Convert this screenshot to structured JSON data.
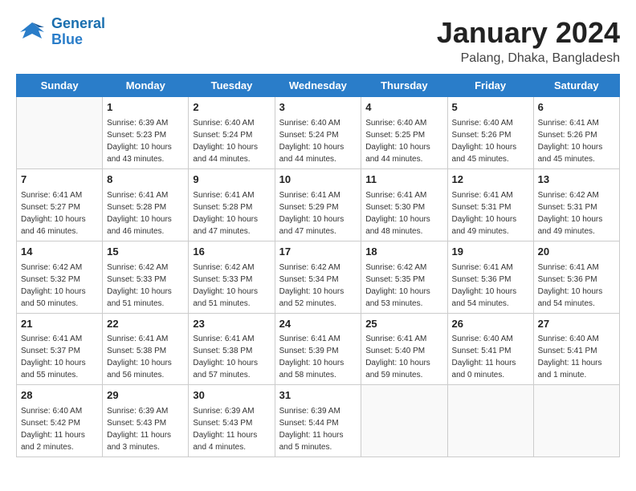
{
  "header": {
    "logo": {
      "line1": "General",
      "line2": "Blue"
    },
    "month_year": "January 2024",
    "location": "Palang, Dhaka, Bangladesh"
  },
  "days_of_week": [
    "Sunday",
    "Monday",
    "Tuesday",
    "Wednesday",
    "Thursday",
    "Friday",
    "Saturday"
  ],
  "weeks": [
    [
      {
        "day": "",
        "detail": ""
      },
      {
        "day": "1",
        "detail": "Sunrise: 6:39 AM\nSunset: 5:23 PM\nDaylight: 10 hours\nand 43 minutes."
      },
      {
        "day": "2",
        "detail": "Sunrise: 6:40 AM\nSunset: 5:24 PM\nDaylight: 10 hours\nand 44 minutes."
      },
      {
        "day": "3",
        "detail": "Sunrise: 6:40 AM\nSunset: 5:24 PM\nDaylight: 10 hours\nand 44 minutes."
      },
      {
        "day": "4",
        "detail": "Sunrise: 6:40 AM\nSunset: 5:25 PM\nDaylight: 10 hours\nand 44 minutes."
      },
      {
        "day": "5",
        "detail": "Sunrise: 6:40 AM\nSunset: 5:26 PM\nDaylight: 10 hours\nand 45 minutes."
      },
      {
        "day": "6",
        "detail": "Sunrise: 6:41 AM\nSunset: 5:26 PM\nDaylight: 10 hours\nand 45 minutes."
      }
    ],
    [
      {
        "day": "7",
        "detail": "Sunrise: 6:41 AM\nSunset: 5:27 PM\nDaylight: 10 hours\nand 46 minutes."
      },
      {
        "day": "8",
        "detail": "Sunrise: 6:41 AM\nSunset: 5:28 PM\nDaylight: 10 hours\nand 46 minutes."
      },
      {
        "day": "9",
        "detail": "Sunrise: 6:41 AM\nSunset: 5:28 PM\nDaylight: 10 hours\nand 47 minutes."
      },
      {
        "day": "10",
        "detail": "Sunrise: 6:41 AM\nSunset: 5:29 PM\nDaylight: 10 hours\nand 47 minutes."
      },
      {
        "day": "11",
        "detail": "Sunrise: 6:41 AM\nSunset: 5:30 PM\nDaylight: 10 hours\nand 48 minutes."
      },
      {
        "day": "12",
        "detail": "Sunrise: 6:41 AM\nSunset: 5:31 PM\nDaylight: 10 hours\nand 49 minutes."
      },
      {
        "day": "13",
        "detail": "Sunrise: 6:42 AM\nSunset: 5:31 PM\nDaylight: 10 hours\nand 49 minutes."
      }
    ],
    [
      {
        "day": "14",
        "detail": "Sunrise: 6:42 AM\nSunset: 5:32 PM\nDaylight: 10 hours\nand 50 minutes."
      },
      {
        "day": "15",
        "detail": "Sunrise: 6:42 AM\nSunset: 5:33 PM\nDaylight: 10 hours\nand 51 minutes."
      },
      {
        "day": "16",
        "detail": "Sunrise: 6:42 AM\nSunset: 5:33 PM\nDaylight: 10 hours\nand 51 minutes."
      },
      {
        "day": "17",
        "detail": "Sunrise: 6:42 AM\nSunset: 5:34 PM\nDaylight: 10 hours\nand 52 minutes."
      },
      {
        "day": "18",
        "detail": "Sunrise: 6:42 AM\nSunset: 5:35 PM\nDaylight: 10 hours\nand 53 minutes."
      },
      {
        "day": "19",
        "detail": "Sunrise: 6:41 AM\nSunset: 5:36 PM\nDaylight: 10 hours\nand 54 minutes."
      },
      {
        "day": "20",
        "detail": "Sunrise: 6:41 AM\nSunset: 5:36 PM\nDaylight: 10 hours\nand 54 minutes."
      }
    ],
    [
      {
        "day": "21",
        "detail": "Sunrise: 6:41 AM\nSunset: 5:37 PM\nDaylight: 10 hours\nand 55 minutes."
      },
      {
        "day": "22",
        "detail": "Sunrise: 6:41 AM\nSunset: 5:38 PM\nDaylight: 10 hours\nand 56 minutes."
      },
      {
        "day": "23",
        "detail": "Sunrise: 6:41 AM\nSunset: 5:38 PM\nDaylight: 10 hours\nand 57 minutes."
      },
      {
        "day": "24",
        "detail": "Sunrise: 6:41 AM\nSunset: 5:39 PM\nDaylight: 10 hours\nand 58 minutes."
      },
      {
        "day": "25",
        "detail": "Sunrise: 6:41 AM\nSunset: 5:40 PM\nDaylight: 10 hours\nand 59 minutes."
      },
      {
        "day": "26",
        "detail": "Sunrise: 6:40 AM\nSunset: 5:41 PM\nDaylight: 11 hours\nand 0 minutes."
      },
      {
        "day": "27",
        "detail": "Sunrise: 6:40 AM\nSunset: 5:41 PM\nDaylight: 11 hours\nand 1 minute."
      }
    ],
    [
      {
        "day": "28",
        "detail": "Sunrise: 6:40 AM\nSunset: 5:42 PM\nDaylight: 11 hours\nand 2 minutes."
      },
      {
        "day": "29",
        "detail": "Sunrise: 6:39 AM\nSunset: 5:43 PM\nDaylight: 11 hours\nand 3 minutes."
      },
      {
        "day": "30",
        "detail": "Sunrise: 6:39 AM\nSunset: 5:43 PM\nDaylight: 11 hours\nand 4 minutes."
      },
      {
        "day": "31",
        "detail": "Sunrise: 6:39 AM\nSunset: 5:44 PM\nDaylight: 11 hours\nand 5 minutes."
      },
      {
        "day": "",
        "detail": ""
      },
      {
        "day": "",
        "detail": ""
      },
      {
        "day": "",
        "detail": ""
      }
    ]
  ]
}
